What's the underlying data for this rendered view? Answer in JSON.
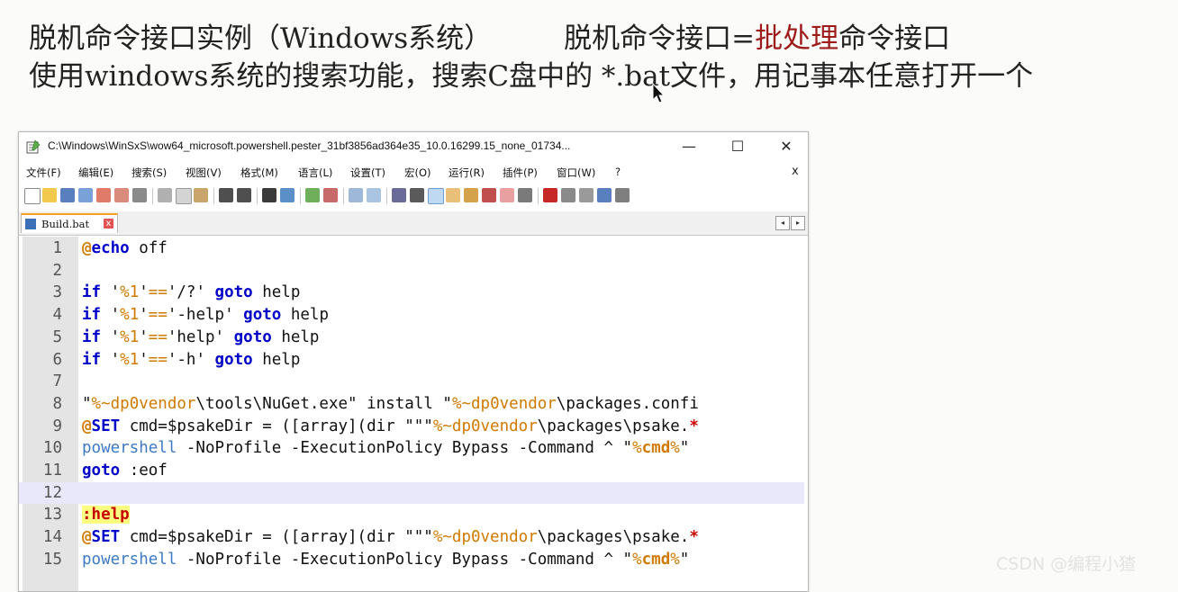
{
  "slide": {
    "line1_left": "脱机命令接口实例（Windows系统）",
    "line1_right_a": "脱机命令接口=",
    "line1_right_red": "批处理",
    "line1_right_b": "命令接口",
    "line2": "使用windows系统的搜索功能，搜索C盘中的 *.bat文件，用记事本任意打开一个"
  },
  "window": {
    "title": "C:\\Windows\\WinSxS\\wow64_microsoft.powershell.pester_31bf3856ad364e35_10.0.16299.15_none_01734...",
    "minimize": "—",
    "maximize": "☐",
    "close": "✕"
  },
  "menu": [
    "文件(F)",
    "编辑(E)",
    "搜索(S)",
    "视图(V)",
    "格式(M)",
    "语言(L)",
    "设置(T)",
    "宏(O)",
    "运行(R)",
    "插件(P)",
    "窗口(W)",
    "?"
  ],
  "menu_close": "x",
  "tab": {
    "name": "Build.bat",
    "close": "x"
  },
  "tab_nav": {
    "prev": "◂",
    "next": "▸"
  },
  "code": {
    "current_line": 12,
    "lines": [
      {
        "n": "1",
        "t": "@echo off"
      },
      {
        "n": "2",
        "t": ""
      },
      {
        "n": "3",
        "t": "if '%1'=='/?' goto help"
      },
      {
        "n": "4",
        "t": "if '%1'=='-help' goto help"
      },
      {
        "n": "5",
        "t": "if '%1'=='help' goto help"
      },
      {
        "n": "6",
        "t": "if '%1'=='-h' goto help"
      },
      {
        "n": "7",
        "t": ""
      },
      {
        "n": "8",
        "t": "\"%~dp0vendor\\tools\\NuGet.exe\" install \"%~dp0vendor\\packages.confi"
      },
      {
        "n": "9",
        "t": "@SET cmd=$psakeDir = ([array](dir \"\"\"%~dp0vendor\\packages\\psake.*"
      },
      {
        "n": "10",
        "t": "powershell -NoProfile -ExecutionPolicy Bypass -Command ^ \"%cmd%\""
      },
      {
        "n": "11",
        "t": "goto :eof"
      },
      {
        "n": "12",
        "t": ""
      },
      {
        "n": "13",
        "t": ":help"
      },
      {
        "n": "14",
        "t": "@SET cmd=$psakeDir = ([array](dir \"\"\"%~dp0vendor\\packages\\psake.*"
      },
      {
        "n": "15",
        "t": "powershell -NoProfile -ExecutionPolicy Bypass -Command ^ \"%cmd%\""
      }
    ]
  },
  "watermark": "CSDN @编程小猹",
  "toolbar_icons": [
    "new-file-icon",
    "open-file-icon",
    "save-icon",
    "save-all-icon",
    "close-icon",
    "close-all-icon",
    "print-icon",
    "cut-icon",
    "copy-icon",
    "paste-icon",
    "undo-icon",
    "redo-icon",
    "find-icon",
    "replace-icon",
    "zoom-in-icon",
    "zoom-out-icon",
    "sync-v-icon",
    "sync-h-icon",
    "wrap-icon",
    "show-all-chars-icon",
    "indent-guide-icon",
    "udl-icon",
    "doc-map-icon",
    "function-list-icon",
    "folder-workspace-icon",
    "monitor-icon",
    "record-macro-icon",
    "stop-macro-icon",
    "play-macro-icon",
    "run-macro-multiple-icon",
    "save-macro-icon"
  ]
}
